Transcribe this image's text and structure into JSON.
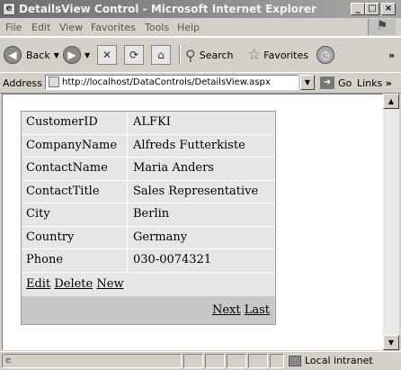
{
  "window": {
    "title": "DetailsView Control - Microsoft Internet Explorer",
    "min": "_",
    "max": "□",
    "close": "×"
  },
  "menu": [
    "File",
    "Edit",
    "View",
    "Favorites",
    "Tools",
    "Help"
  ],
  "toolbar": {
    "back": "Back",
    "search": "Search",
    "favorites": "Favorites",
    "overflow": "»"
  },
  "address": {
    "label": "Address",
    "url": "http://localhost/DataControls/DetailsView.aspx",
    "go": "Go",
    "links": "Links",
    "links_overflow": "»"
  },
  "details": {
    "rows": [
      {
        "field": "CustomerID",
        "value": "ALFKI"
      },
      {
        "field": "CompanyName",
        "value": "Alfreds Futterkiste"
      },
      {
        "field": "ContactName",
        "value": "Maria Anders"
      },
      {
        "field": "ContactTitle",
        "value": "Sales Representative"
      },
      {
        "field": "City",
        "value": "Berlin"
      },
      {
        "field": "Country",
        "value": "Germany"
      },
      {
        "field": "Phone",
        "value": "030-0074321"
      }
    ],
    "commands": {
      "edit": "Edit",
      "delete": "Delete",
      "new": "New"
    },
    "pager": {
      "next": "Next",
      "last": "Last"
    }
  },
  "status": {
    "zone": "Local intranet"
  },
  "colors": {
    "title_bar": "#8c8c8c",
    "details_background": "#e6e6e6",
    "pager_background": "#c8c8c8"
  }
}
